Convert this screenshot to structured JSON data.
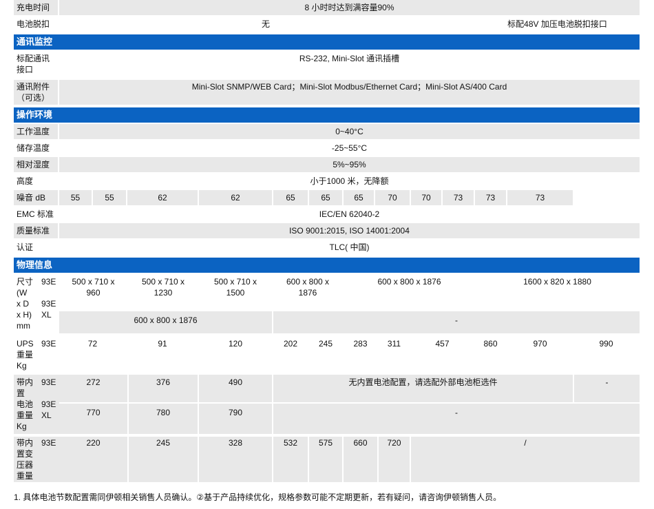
{
  "sections": {
    "comm": "通讯监控",
    "env": "操作环境",
    "phys": "物理信息"
  },
  "rows": {
    "charge_time": {
      "label": "充电时间",
      "value": "8 小时时达到满容量90%"
    },
    "battery_release": {
      "label": "电池脱扣",
      "value_left": "无",
      "value_right": "标配48V 加压电池脱扣接口"
    },
    "std_comm": {
      "label": [
        "标配通讯",
        "接口"
      ],
      "value": "RS-232, Mini-Slot 通讯插槽"
    },
    "comm_acc": {
      "label": [
        "通讯附件",
        "（可选）"
      ],
      "value": "Mini-Slot SNMP/WEB Card；Mini-Slot Modbus/Ethernet Card；Mini-Slot AS/400 Card"
    },
    "op_temp": {
      "label": "工作温度",
      "value": "0~40°C"
    },
    "store_temp": {
      "label": "储存温度",
      "value": "-25~55°C"
    },
    "humidity": {
      "label": "相对湿度",
      "value": "5%~95%"
    },
    "altitude": {
      "label": "高度",
      "value": "小于1000 米，无降额"
    },
    "noise": {
      "label": "噪音 dB",
      "values": [
        "55",
        "55",
        "62",
        "62",
        "65",
        "65",
        "65",
        "70",
        "70",
        "73",
        "73",
        "73"
      ]
    },
    "emc": {
      "label": "EMC 标准",
      "value": "IEC/EN 62040-2"
    },
    "quality": {
      "label": "质量标准",
      "value": "ISO 9001:2015, ISO 14001:2004"
    },
    "cert": {
      "label": "认证",
      "value": "TLC( 中国)"
    }
  },
  "physical": {
    "size": {
      "label": [
        "尺寸",
        "(W",
        "x D",
        "x H)",
        "mm"
      ],
      "e_label": "93E",
      "xl_label": [
        "93E",
        "XL"
      ],
      "e_values": [
        [
          "500 x 710 x",
          "960"
        ],
        [
          "500 x 710 x",
          "1230"
        ],
        [
          "500 x 710 x",
          "1500"
        ],
        [
          "600 x 800 x",
          "1876"
        ],
        [
          "600 x 800 x 1876"
        ],
        [
          "1600 x 820 x 1880"
        ]
      ],
      "xl_values": [
        "600 x 800 x 1876",
        "-"
      ]
    },
    "ups_weight": {
      "label": [
        "UPS",
        "重量",
        "Kg"
      ],
      "e_label": "93E",
      "values": [
        "72",
        "91",
        "120",
        "202",
        "245",
        "283",
        "311",
        "457",
        "860",
        "970",
        "990"
      ]
    },
    "batt_weight": {
      "label": [
        "带内",
        "置",
        "电池",
        "重量",
        "Kg"
      ],
      "e_label": "93E",
      "xl_label": [
        "93E",
        "XL"
      ],
      "e_values": [
        "272",
        "376",
        "490",
        "无内置电池配置，请选配外部电池柜选件",
        "-"
      ],
      "xl_values": [
        "770",
        "780",
        "790",
        "-"
      ]
    },
    "xfmr_weight": {
      "label": [
        "带内",
        "置变",
        "压器",
        "重量"
      ],
      "e_label": "93E",
      "values": [
        "220",
        "245",
        "328",
        "532",
        "575",
        "660",
        "720",
        "/"
      ]
    }
  },
  "footnote": "1. 具体电池节数配置需同伊顿相关销售人员确认。②基于产品持续优化，规格参数可能不定期更新，若有疑问，请咨询伊顿销售人员。"
}
